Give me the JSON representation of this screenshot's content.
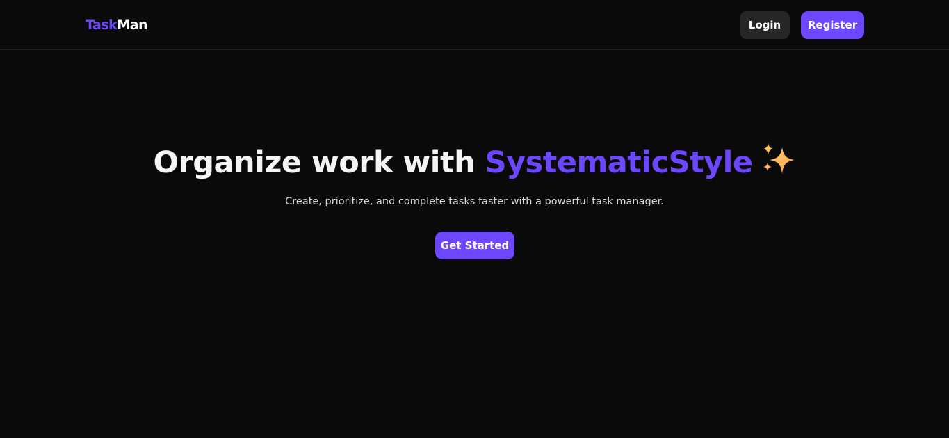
{
  "header": {
    "logo_part1": "Task",
    "logo_part2": "Man",
    "login_label": "Login",
    "register_label": "Register"
  },
  "hero": {
    "title_prefix": "Organize work with ",
    "title_highlight": "SystematicStyle",
    "title_icon": "sparkles-icon",
    "subtitle": "Create, prioritize, and complete tasks faster with a powerful task manager.",
    "cta_label": "Get Started"
  },
  "colors": {
    "background": "#0a0a0a",
    "accent": "#6d47ff",
    "secondary_button": "#262626",
    "text": "#ffffff"
  }
}
